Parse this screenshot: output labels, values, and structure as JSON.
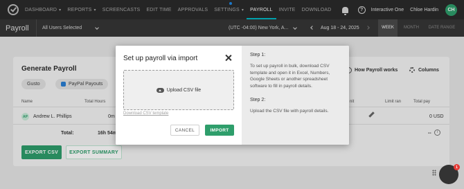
{
  "nav": {
    "items": [
      {
        "label": "DASHBOARD",
        "caret": true
      },
      {
        "label": "REPORTS",
        "caret": true
      },
      {
        "label": "SCREENCASTS",
        "caret": false
      },
      {
        "label": "EDIT TIME",
        "caret": false
      },
      {
        "label": "APPROVALS",
        "caret": false
      },
      {
        "label": "SETTINGS",
        "caret": true
      },
      {
        "label": "PAYROLL",
        "caret": false
      },
      {
        "label": "INVITE",
        "caret": false
      },
      {
        "label": "DOWNLOAD",
        "caret": false
      }
    ],
    "active": "PAYROLL",
    "help_glyph": "?",
    "workspace": "Interactive One",
    "user_name": "Chloe Hardin",
    "avatar_initials": "CH"
  },
  "subheader": {
    "page_title": "Payroll",
    "user_filter": "All Users Selected",
    "timezone": "(UTC -04:00) New York, A...",
    "date_range": "Aug 18 - 24, 2025",
    "range_modes": [
      "WEEK",
      "MONTH",
      "DATE RANGE"
    ],
    "active_mode": "WEEK"
  },
  "card": {
    "title": "Generate Payroll",
    "chips": [
      "Gusto",
      "PayPal Payouts"
    ],
    "how_payroll_works": "How Payroll works",
    "columns_label": "Columns",
    "headers": {
      "name": "Name",
      "total_hours": "Total Hours",
      "unit": "nit",
      "limit": "Limit ran",
      "total_pay": "Total pay"
    },
    "row": {
      "avatar": "AP",
      "name": "Andrew L. Phillips",
      "hours": "0m",
      "total_pay": "0 USD"
    },
    "total": {
      "label": "Total:",
      "hours": "16h 54m",
      "pay": "--"
    },
    "export_csv": "EXPORT CSV",
    "export_summary": "EXPORT SUMMARY"
  },
  "modal": {
    "title": "Set up payroll via import",
    "upload_label": "Upload CSV file",
    "download_template": "Download CSV template",
    "cancel": "CANCEL",
    "import": "IMPORT",
    "step1_title": "Step 1:",
    "step1_text": "To set up payroll in bulk, download CSV template and open it in Excel, Numbers, Google Sheets or another spreadsheet software to fill in payroll details.",
    "step2_title": "Step 2:",
    "step2_text": "Upload the CSV file with payroll details."
  },
  "chat": {
    "badge": "1"
  },
  "colors": {
    "accent_green": "#2e9e6b",
    "nav_bg": "#2b2b2b",
    "active_underline": "#00b8c4"
  }
}
